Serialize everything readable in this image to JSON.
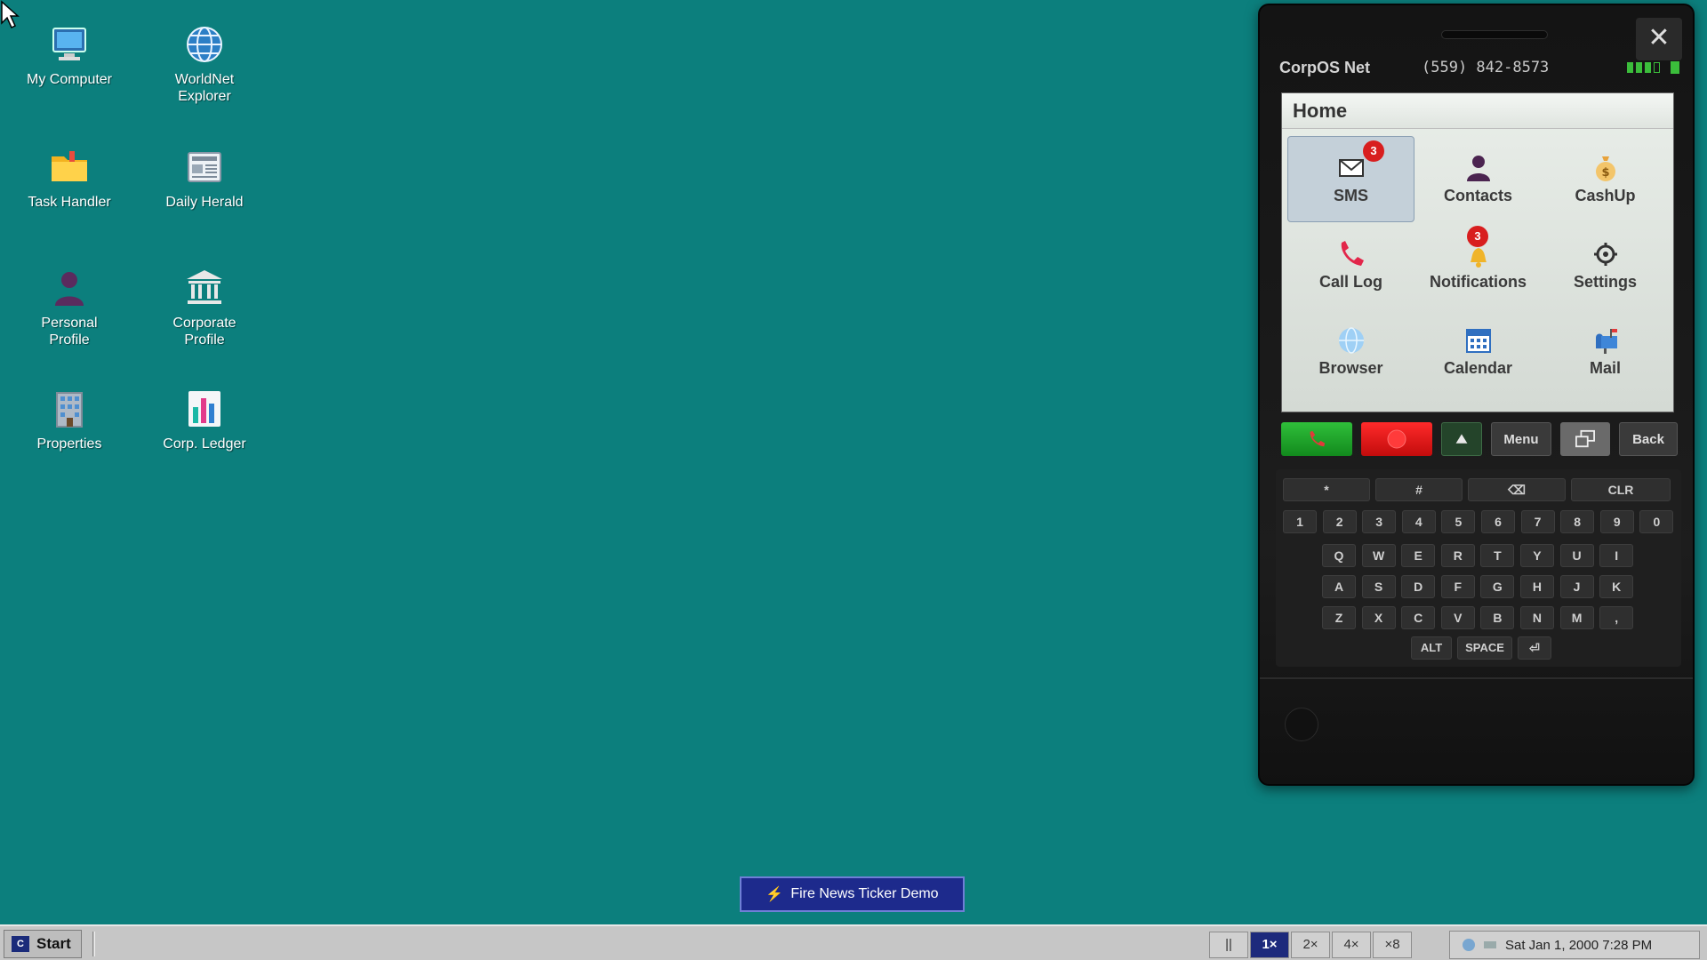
{
  "desktop": {
    "icons": [
      {
        "label": "My Computer",
        "icon": "computer-icon"
      },
      {
        "label": "WorldNet Explorer",
        "icon": "globe-icon"
      },
      {
        "label": "Task Handler",
        "icon": "folder-icon"
      },
      {
        "label": "Daily Herald",
        "icon": "newspaper-icon"
      },
      {
        "label": "Personal Profile",
        "icon": "person-icon"
      },
      {
        "label": "Corporate Profile",
        "icon": "bank-icon"
      },
      {
        "label": "Properties",
        "icon": "building-icon"
      },
      {
        "label": "Corp. Ledger",
        "icon": "ledger-chart-icon"
      }
    ]
  },
  "phone": {
    "close_label": "✕",
    "carrier": "CorpOS Net",
    "number": "(559) 842-8573",
    "screen_title": "Home",
    "apps": [
      {
        "label": "SMS",
        "icon": "envelope-icon",
        "badge": "3",
        "selected": true
      },
      {
        "label": "Contacts",
        "icon": "person-icon",
        "badge": ""
      },
      {
        "label": "CashUp",
        "icon": "money-bag-icon",
        "badge": ""
      },
      {
        "label": "Call Log",
        "icon": "phone-handset-icon",
        "badge": ""
      },
      {
        "label": "Notifications",
        "icon": "bell-icon",
        "badge": "3"
      },
      {
        "label": "Settings",
        "icon": "gear-icon",
        "badge": ""
      },
      {
        "label": "Browser",
        "icon": "globe-icon",
        "badge": ""
      },
      {
        "label": "Calendar",
        "icon": "calendar-icon",
        "badge": ""
      },
      {
        "label": "Mail",
        "icon": "mailbox-icon",
        "badge": ""
      }
    ],
    "controls": {
      "menu": "Menu",
      "back": "Back"
    },
    "keyboard": {
      "symbols": [
        "*",
        "#",
        "⌫",
        "CLR"
      ],
      "digits": [
        "1",
        "2",
        "3",
        "4",
        "5",
        "6",
        "7",
        "8",
        "9",
        "0"
      ],
      "row1": [
        "Q",
        "W",
        "E",
        "R",
        "T",
        "Y",
        "U",
        "I"
      ],
      "row2": [
        "A",
        "S",
        "D",
        "F",
        "G",
        "H",
        "J",
        "K"
      ],
      "row3": [
        "Z",
        "X",
        "C",
        "V",
        "B",
        "N",
        "M",
        ","
      ],
      "bottom": [
        "ALT",
        "SPACE",
        "⏎"
      ]
    }
  },
  "ticker_button": "Fire News Ticker Demo",
  "taskbar": {
    "start": "Start",
    "speeds": [
      "||",
      "1×",
      "2×",
      "4×",
      "×8"
    ],
    "active_speed": "1×",
    "clock": "Sat Jan 1, 2000 7:28 PM"
  },
  "colors": {
    "desktop": "#0c7f7d",
    "accent": "#1d2a8c",
    "badge": "#d81e1e"
  }
}
